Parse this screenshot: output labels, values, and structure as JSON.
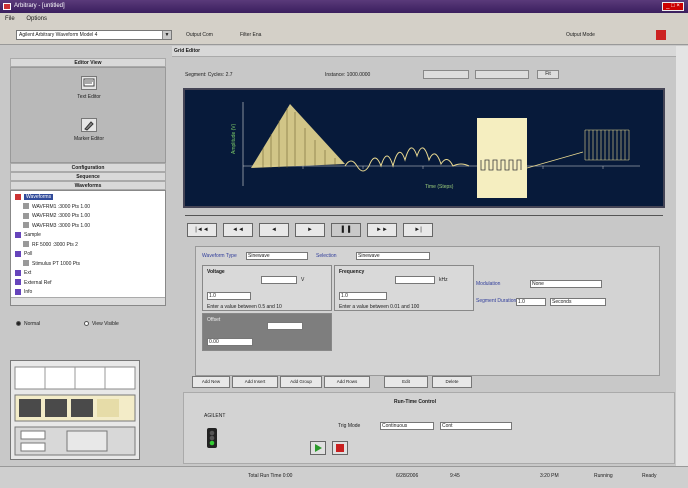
{
  "window": {
    "title": "Arbitrary - [untitled]",
    "controls": "_ □ ×"
  },
  "menu": [
    "File",
    "Options"
  ],
  "toolbar": {
    "instrument": "Agilent Arbitrary Waveform Model 4",
    "item1": "Output Com",
    "item2": "Filter Ena",
    "right_label": "Output Mode"
  },
  "editor_title": "Grid Editor",
  "left": {
    "editor_view_title": "Editor View",
    "view_items": [
      "Text Editor",
      "Marker Editor"
    ],
    "sections": [
      "Configuration",
      "Sequence",
      "Waveforms"
    ],
    "tree": [
      "Waveforms",
      "WAVFRM1 :3000 Pts 1.00",
      "WAVFRM2 :3000 Pts 1.00",
      "WAVFRM3 :3000 Pts 1.00",
      "Sample",
      "RF 5000 :3000 Pts 2",
      "Poll",
      "Stimulus PT 1000 Pts",
      "Ext",
      "External Ref",
      "Info"
    ],
    "radio1": "Normal",
    "radio2": "View Visible"
  },
  "main": {
    "toolbar_caption": "Segment: Cycles: 2.7",
    "toolbar_label2": "Instance: 1000.0000",
    "toolbar_btn": "Fit",
    "plot": {
      "xlabel": "Time (Steps)",
      "ylabel": "Amplitude (V)"
    },
    "nav": [
      "|◄◄",
      "◄◄",
      "◄",
      "►",
      "▌▐",
      "►►",
      "►|"
    ],
    "params": {
      "waveform_type_label": "Waveform Type",
      "waveform_type": "Sinewave",
      "selection_label": "Selection",
      "selection": "Sinewave",
      "voltage_label": "Voltage",
      "voltage": "1.0",
      "voltage_unit": "V",
      "voltage_hint": "Enter a value between 0.5 and 10",
      "frequency_label": "Frequency",
      "frequency": "1.0",
      "frequency_unit": "kHz",
      "frequency_hint": "Enter a value between 0.01 and 100",
      "offset_label": "Offset",
      "offset": "0.00",
      "modulation_label": "Modulation",
      "modulation": "None",
      "segment_label": "Segment Duration",
      "segment_value": "1.0",
      "segment_unit": "Seconds"
    },
    "tabs": [
      "Add New",
      "Add Insert",
      "Add Group",
      "Add Rows",
      "Edit",
      "Delete"
    ],
    "runtime": {
      "title": "Run-Time Control",
      "device": "AGILENT",
      "trig_label": "Trig Mode",
      "trig_value": "Continuous",
      "trig_unit": "Cont"
    }
  },
  "status": {
    "s1": "Total Run Time 0:00",
    "s2": "6/28/2006",
    "s3": "9:45",
    "s4": "3:20 PM",
    "s5": "Running",
    "s6": "Ready"
  },
  "colors": {
    "accent": "#3a1f5e",
    "plot_bg": "#071a3a",
    "wave": "#e8d890",
    "selected_segment": "#f5eec0"
  }
}
